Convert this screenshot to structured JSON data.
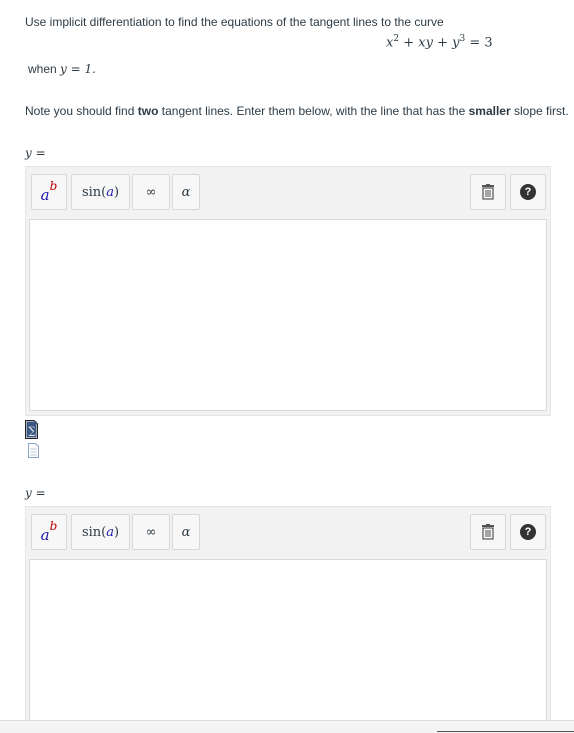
{
  "question": {
    "intro": "Use implicit differentiation to find the equations of the tangent lines to the curve",
    "equation": {
      "x2": "x",
      "x2_exp": "2",
      "plus1": " + ",
      "xy": "xy",
      "plus2": " + ",
      "y3": "y",
      "y3_exp": "3",
      "equals": " = 3"
    },
    "when_prefix": "when ",
    "when_math": "y = 1.",
    "note_part1": "Note you should find ",
    "note_bold1": "two",
    "note_part2": " tangent lines. Enter them below, with the line that has the ",
    "note_bold2": "smaller",
    "note_part3": " slope first."
  },
  "answers": [
    {
      "label": "y ="
    },
    {
      "label": "y ="
    }
  ],
  "toolbar": {
    "superscript_a": "a",
    "superscript_b": "b",
    "sin_label": "sin ",
    "sin_open": "(",
    "sin_arg": "a",
    "sin_close": ")",
    "infinity": "∞",
    "alpha": "α",
    "help": "?"
  },
  "icons": {
    "sigma": "sigma-equation-icon",
    "file": "file-icon",
    "trash": "trash-icon",
    "help": "help-icon"
  }
}
